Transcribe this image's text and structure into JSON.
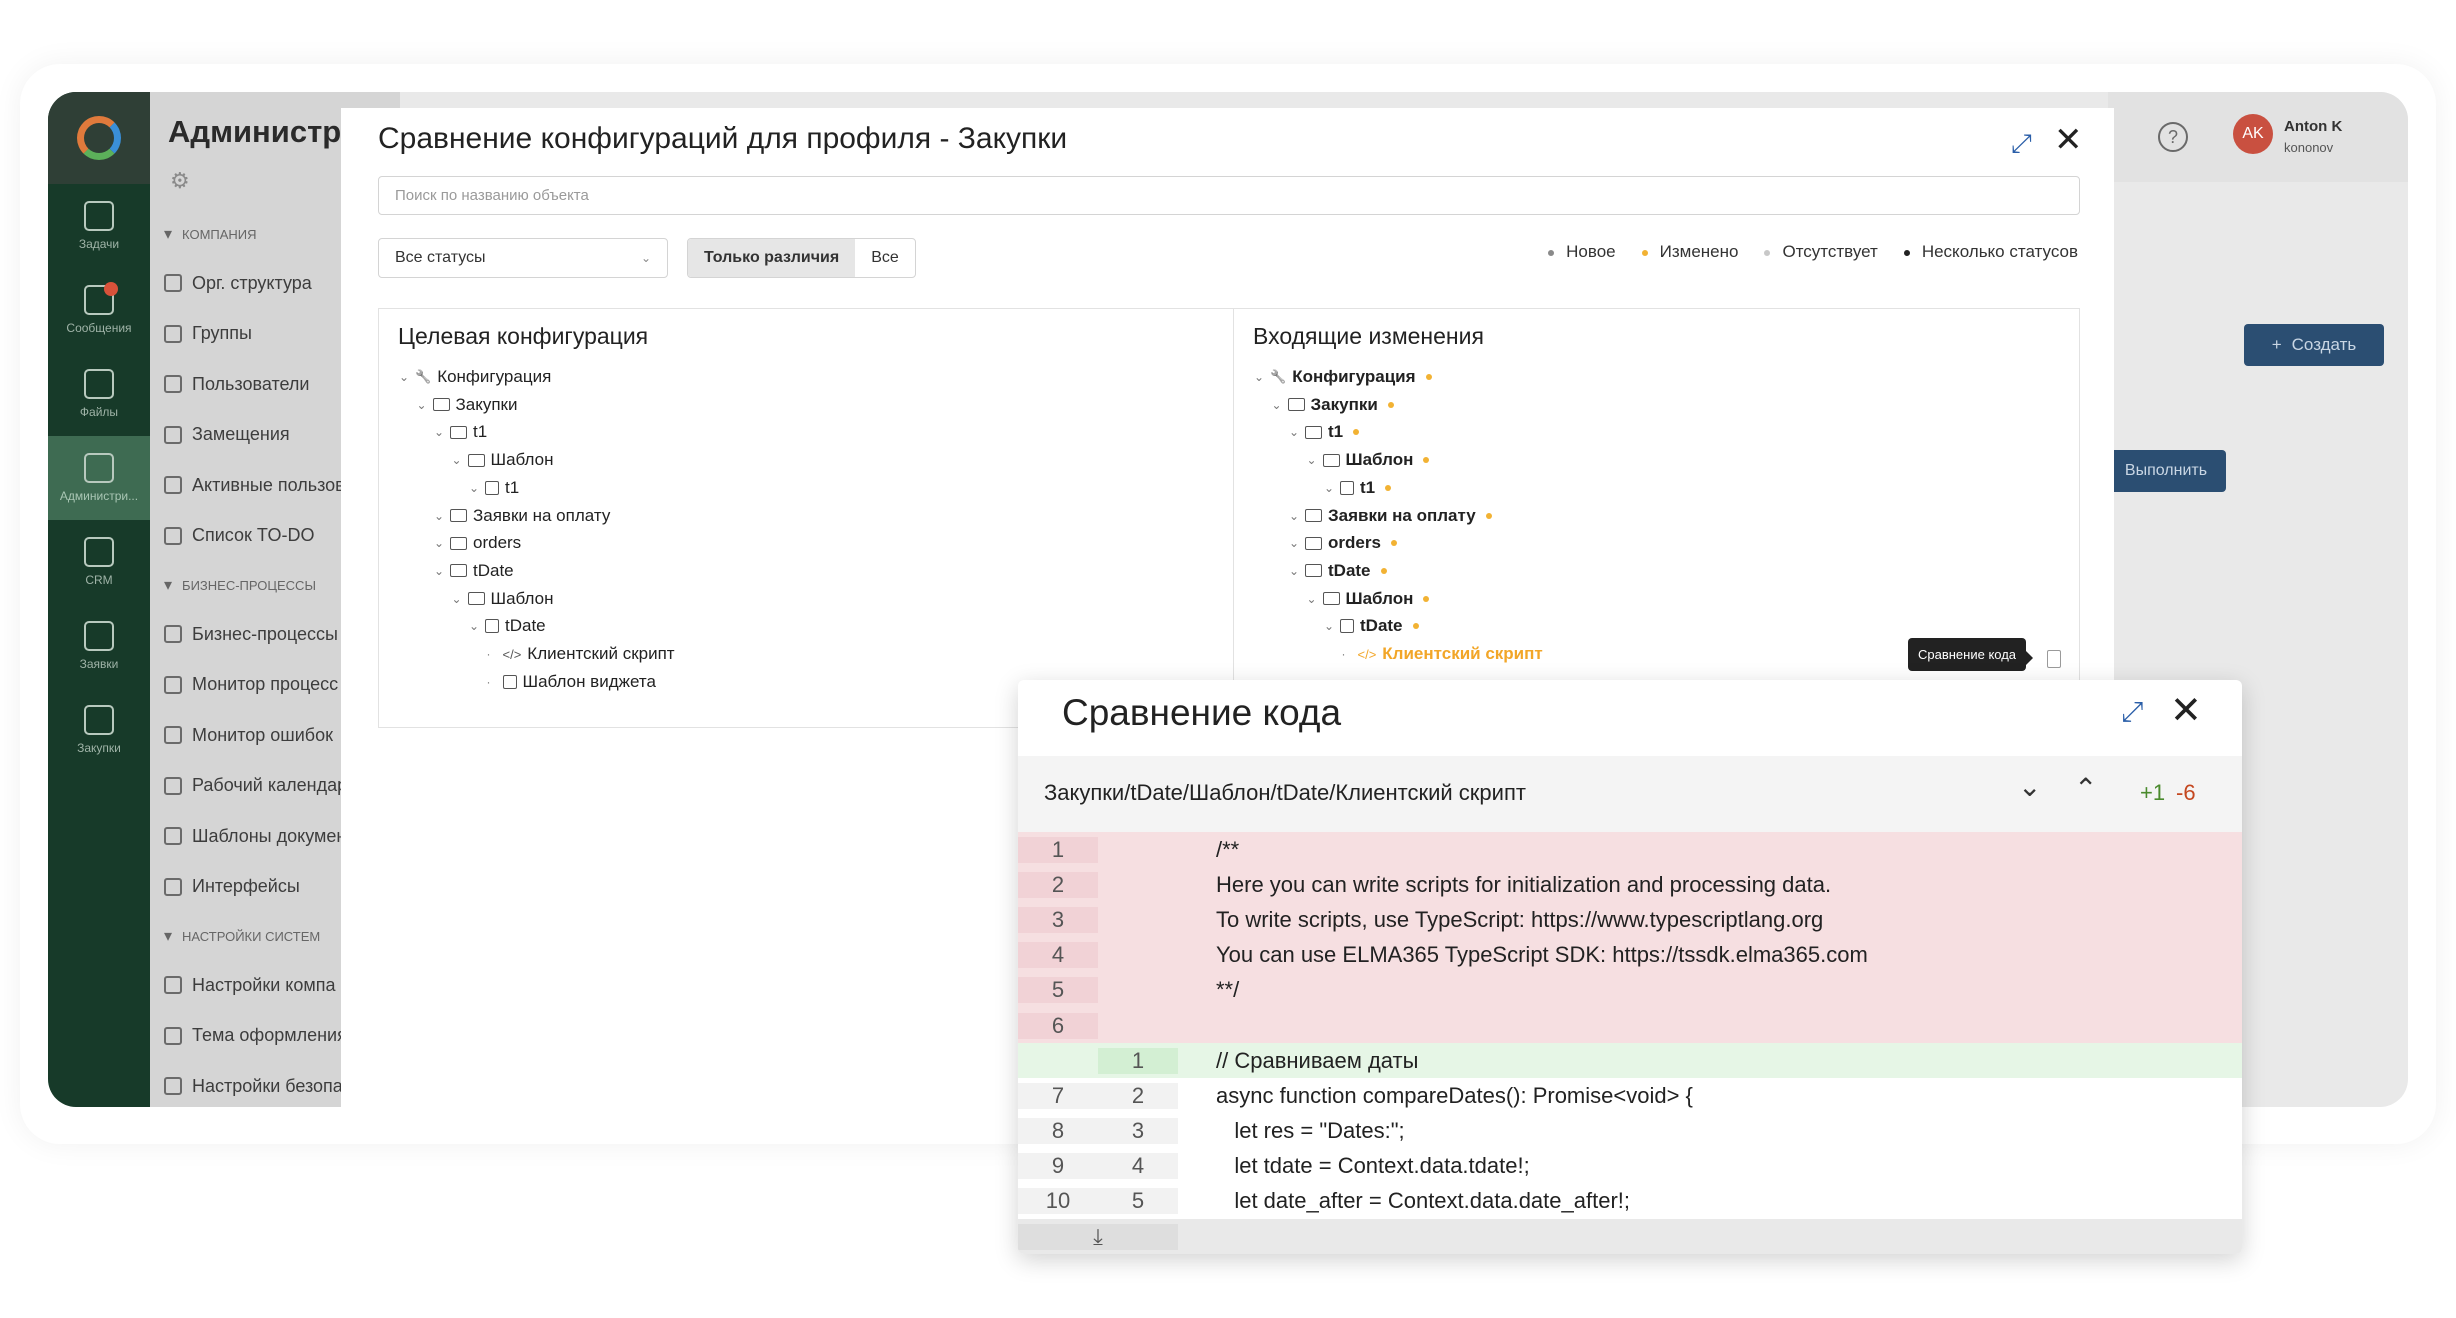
{
  "sidebar": {
    "title": "Администри",
    "rail": [
      {
        "label": "Задачи",
        "icon": "tasks-icon"
      },
      {
        "label": "Сообщения",
        "icon": "messages-icon"
      },
      {
        "label": "Файлы",
        "icon": "files-icon"
      },
      {
        "label": "Администри...",
        "icon": "gear-icon"
      },
      {
        "label": "CRM",
        "icon": "crm-icon"
      },
      {
        "label": "Заявки",
        "icon": "requests-icon"
      },
      {
        "label": "Закупки",
        "icon": "cart-icon"
      }
    ],
    "sections": [
      {
        "title": "КОМПАНИЯ",
        "items": [
          "Орг. структура",
          "Группы",
          "Пользователи",
          "Замещения",
          "Активные пользов",
          "Список TO-DO"
        ]
      },
      {
        "title": "БИЗНЕС-ПРОЦЕССЫ",
        "items": [
          "Бизнес-процессы",
          "Монитор процесс",
          "Монитор ошибок",
          "Рабочий календар",
          "Шаблоны докумен",
          "Интерфейсы"
        ]
      },
      {
        "title": "НАСТРОЙКИ СИСТЕМ",
        "items": [
          "Настройки компа",
          "Тема оформления",
          "Настройки безопа"
        ]
      }
    ]
  },
  "header": {
    "help": "?",
    "avatar_initials": "AK",
    "user_name": "Anton K",
    "user_login": "kononov",
    "create_label": "Создать",
    "run_label": "Выполнить"
  },
  "modal": {
    "title": "Сравнение конфигураций для профиля - Закупки",
    "search_placeholder": "Поиск по названию объекта",
    "status_select": "Все статусы",
    "segment": [
      "Только различия",
      "Все"
    ],
    "legend": [
      {
        "label": "Новое",
        "color": "#8a8a8a"
      },
      {
        "label": "Изменено",
        "color": "#f2b233"
      },
      {
        "label": "Отсутствует",
        "color": "#c8c8c8"
      },
      {
        "label": "Несколько статусов",
        "color": "#222222"
      }
    ],
    "left_title": "Целевая конфигурация",
    "right_title": "Входящие изменения",
    "tree": [
      {
        "label": "Конфигурация",
        "level": 0,
        "icon": "wrench-icon"
      },
      {
        "label": "Закупки",
        "level": 1,
        "icon": "folder-icon"
      },
      {
        "label": "t1",
        "level": 2,
        "icon": "folder-icon"
      },
      {
        "label": "Шаблон",
        "level": 3,
        "icon": "folder-icon"
      },
      {
        "label": "t1",
        "level": 4,
        "icon": "calendar-icon"
      },
      {
        "label": "Заявки на оплату",
        "level": 2,
        "icon": "folder-icon"
      },
      {
        "label": "orders",
        "level": 2,
        "icon": "folder-icon"
      },
      {
        "label": "tDate",
        "level": 2,
        "icon": "folder-icon"
      },
      {
        "label": "Шаблон",
        "level": 3,
        "icon": "folder-icon"
      },
      {
        "label": "tDate",
        "level": 4,
        "icon": "calendar-icon"
      },
      {
        "label": "Клиентский скрипт",
        "level": 5,
        "icon": "code-icon"
      },
      {
        "label": "Шаблон виджета",
        "level": 5,
        "icon": "widget-icon"
      }
    ],
    "tooltip": "Сравнение кода"
  },
  "code_compare": {
    "title": "Сравнение кода",
    "path": "Закупки/tDate/Шаблон/tDate/Клиентский скрипт",
    "added": "+1",
    "removed": "-6",
    "lines": [
      {
        "old": "1",
        "new": "",
        "type": "del",
        "text": "/**"
      },
      {
        "old": "2",
        "new": "",
        "type": "del",
        "text": "Here you can write scripts for initialization and processing data."
      },
      {
        "old": "3",
        "new": "",
        "type": "del",
        "text": "To write scripts, use TypeScript: https://www.typescriptlang.org"
      },
      {
        "old": "4",
        "new": "",
        "type": "del",
        "text": "You can use ELMA365 TypeScript SDK: https://tssdk.elma365.com"
      },
      {
        "old": "5",
        "new": "",
        "type": "del",
        "text": "**/"
      },
      {
        "old": "6",
        "new": "",
        "type": "del",
        "text": ""
      },
      {
        "old": "",
        "new": "1",
        "type": "add",
        "text": "// Сравниваем даты"
      },
      {
        "old": "7",
        "new": "2",
        "type": "ctx",
        "text": "async function compareDates(): Promise<void> {"
      },
      {
        "old": "8",
        "new": "3",
        "type": "ctx",
        "text": "   let res = \"Dates:\";"
      },
      {
        "old": "9",
        "new": "4",
        "type": "ctx",
        "text": "   let tdate = Context.data.tdate!;"
      },
      {
        "old": "10",
        "new": "5",
        "type": "ctx",
        "text": "   let date_after = Context.data.date_after!;"
      }
    ]
  }
}
